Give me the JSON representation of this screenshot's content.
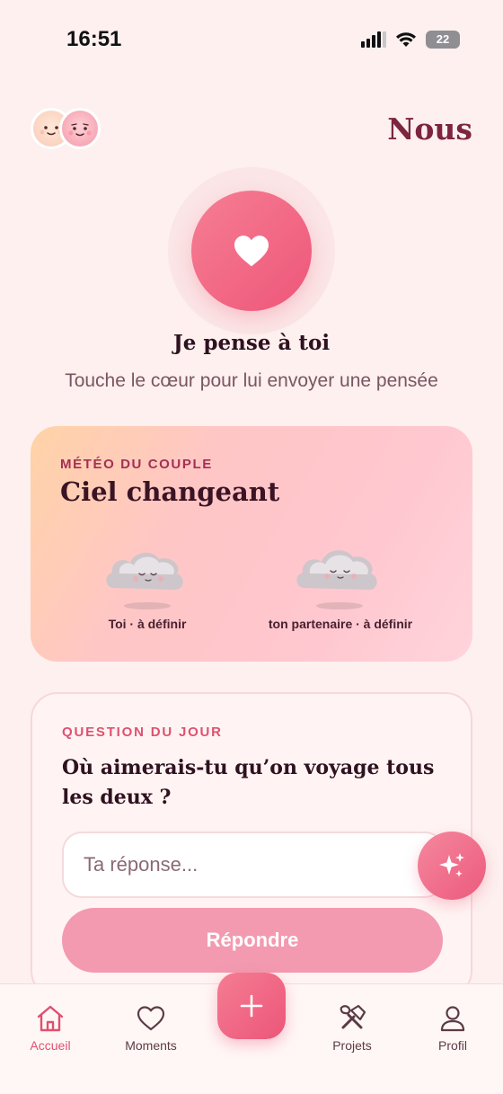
{
  "status_bar": {
    "time": "16:51",
    "battery": "22"
  },
  "header": {
    "title": "Nous"
  },
  "thought": {
    "title": "Je pense à toi",
    "subtitle": "Touche le cœur pour lui envoyer une pensée"
  },
  "weather": {
    "label": "MÉTÉO DU COUPLE",
    "value": "Ciel changeant",
    "people": [
      {
        "caption": "Toi · à définir"
      },
      {
        "caption": "ton partenaire · à définir"
      }
    ]
  },
  "question": {
    "label": "QUESTION DU JOUR",
    "text": "Où aimerais-tu qu’on voyage tous les deux ?",
    "placeholder": "Ta réponse...",
    "submit_label": "Répondre"
  },
  "tabs": [
    {
      "label": "Accueil",
      "icon": "home-icon",
      "active": true
    },
    {
      "label": "Moments",
      "icon": "heart-outline-icon",
      "active": false
    },
    {
      "label": "Projets",
      "icon": "tools-icon",
      "active": false
    },
    {
      "label": "Profil",
      "icon": "person-icon",
      "active": false
    }
  ],
  "colors": {
    "accent": "#ee5679",
    "title": "#7d2440",
    "background": "#fdf0ef"
  }
}
